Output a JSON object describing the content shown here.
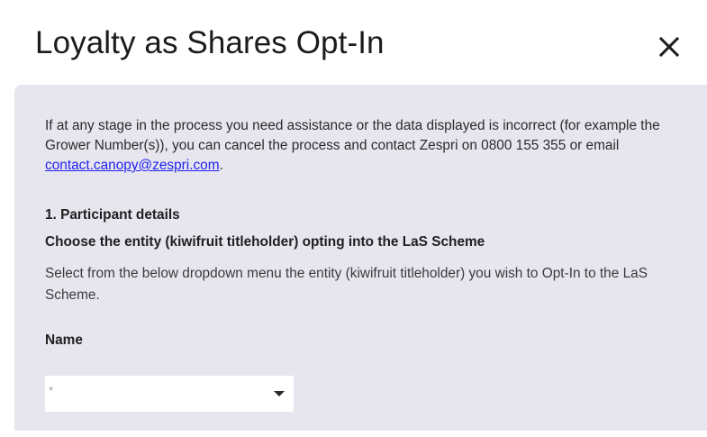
{
  "dialog": {
    "title": "Loyalty as Shares Opt-In",
    "close_icon": "close-icon"
  },
  "content": {
    "intro_text": "If at any stage in the process you need assistance or the data displayed is incorrect (for example the Grower Number(s)), you can cancel the process and contact Zespri on 0800 155 355 or email ",
    "intro_link": "contact.canopy@zespri.com",
    "intro_end": ".",
    "section_heading": "1. Participant details",
    "sub_heading": "Choose the entity (kiwifruit titleholder) opting into the LaS Scheme",
    "instructions": "Select from the below dropdown menu the entity (kiwifruit titleholder) you wish to Opt-In to the LaS Scheme.",
    "name_label": "Name",
    "select_required_marker": "*",
    "select_value": ""
  },
  "colors": {
    "panel_bg": "#e7e6ef",
    "link": "#2222ee",
    "title": "#1c1c1c"
  }
}
